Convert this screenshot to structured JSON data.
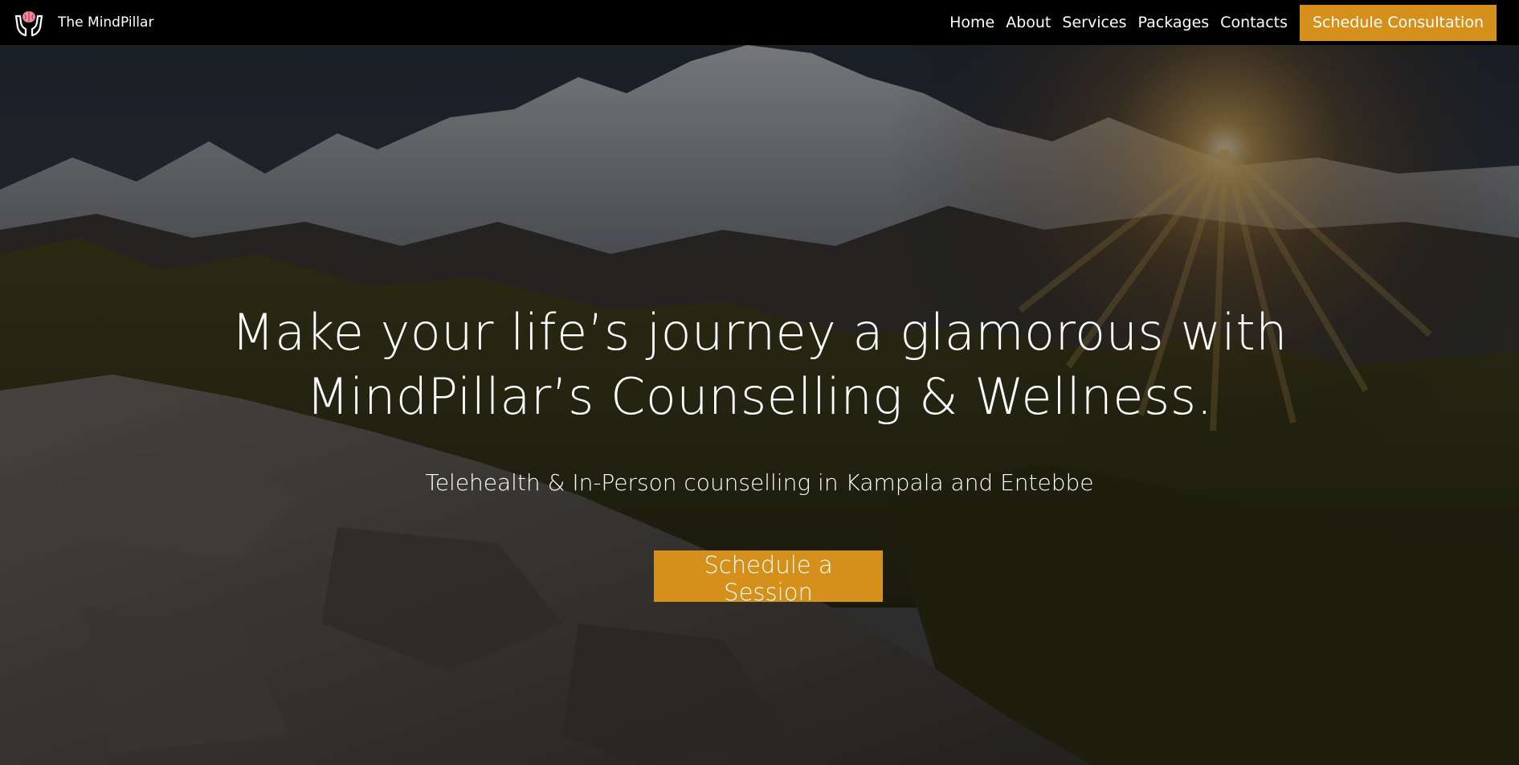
{
  "brand": {
    "name": "The MindPillar",
    "logo_icon": "hands-brain-icon"
  },
  "nav": {
    "items": [
      {
        "label": "Home"
      },
      {
        "label": "About"
      },
      {
        "label": "Services"
      },
      {
        "label": "Packages"
      },
      {
        "label": "Contacts"
      }
    ],
    "cta_label": "Schedule Consultation"
  },
  "hero": {
    "title": "Make your life’s journey a glamorous with MindPillar’s Counselling & Wellness.",
    "subtitle": "Telehealth & In-Person counselling in Kampala and Entebbe",
    "cta_label": "Schedule a Session",
    "background_image": "mountain-sunrise-landscape"
  },
  "colors": {
    "accent": "#d4901a",
    "navbar_bg": "#000000",
    "text": "#ffffff"
  }
}
